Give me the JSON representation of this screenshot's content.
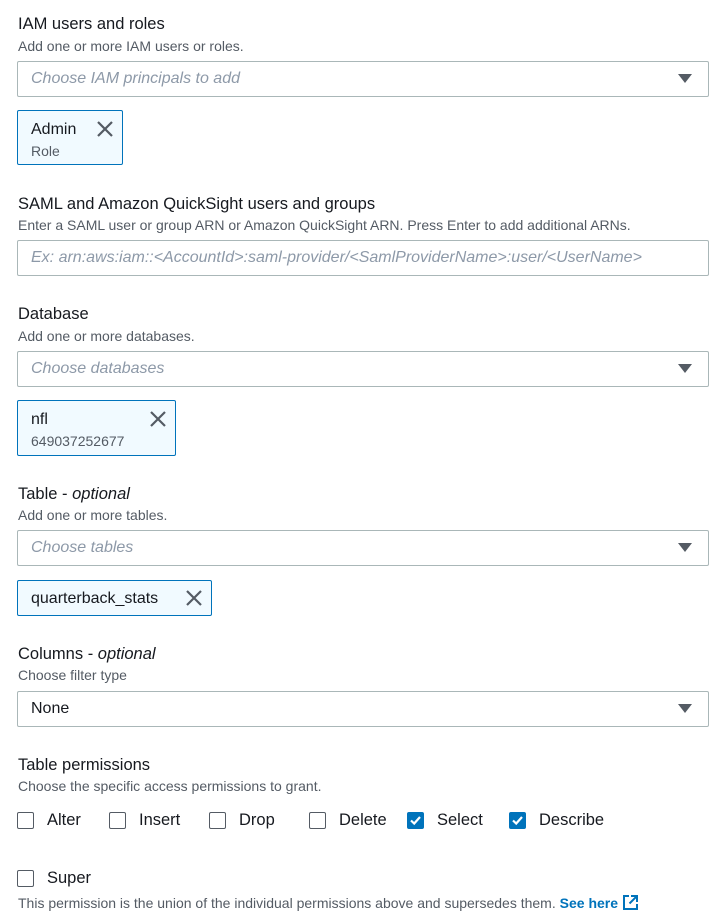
{
  "iam": {
    "label": "IAM users and roles",
    "description": "Add one or more IAM users or roles.",
    "placeholder": "Choose IAM principals to add",
    "tokens": [
      {
        "name": "Admin",
        "detail": "Role"
      }
    ]
  },
  "saml": {
    "label": "SAML and Amazon QuickSight users and groups",
    "description": "Enter a SAML user or group ARN or Amazon QuickSight ARN. Press Enter to add additional ARNs.",
    "placeholder": "Ex: arn:aws:iam::<AccountId>:saml-provider/<SamlProviderName>:user/<UserName>"
  },
  "database": {
    "label": "Database",
    "description": "Add one or more databases.",
    "placeholder": "Choose databases",
    "tokens": [
      {
        "name": "nfl",
        "detail": "649037252677"
      }
    ]
  },
  "table": {
    "label": "Table - ",
    "optional": "optional",
    "description": "Add one or more tables.",
    "placeholder": "Choose tables",
    "tokens": [
      {
        "name": "quarterback_stats"
      }
    ]
  },
  "columns": {
    "label": "Columns - ",
    "optional": "optional",
    "description": "Choose filter type",
    "value": "None"
  },
  "permissions": {
    "label": "Table permissions",
    "description": "Choose the specific access permissions to grant.",
    "items": [
      {
        "label": "Alter",
        "checked": false
      },
      {
        "label": "Insert",
        "checked": false
      },
      {
        "label": "Drop",
        "checked": false
      },
      {
        "label": "Delete",
        "checked": false
      },
      {
        "label": "Select",
        "checked": true
      },
      {
        "label": "Describe",
        "checked": true
      }
    ],
    "super": {
      "label": "Super",
      "checked": false
    },
    "footnote": "This permission is the union of the individual permissions above and supersedes them.",
    "link_text": "See here"
  },
  "colors": {
    "accent": "#0073bb",
    "token_bg": "#f1faff",
    "border": "#aab7b8",
    "placeholder": "#8d99a8"
  }
}
